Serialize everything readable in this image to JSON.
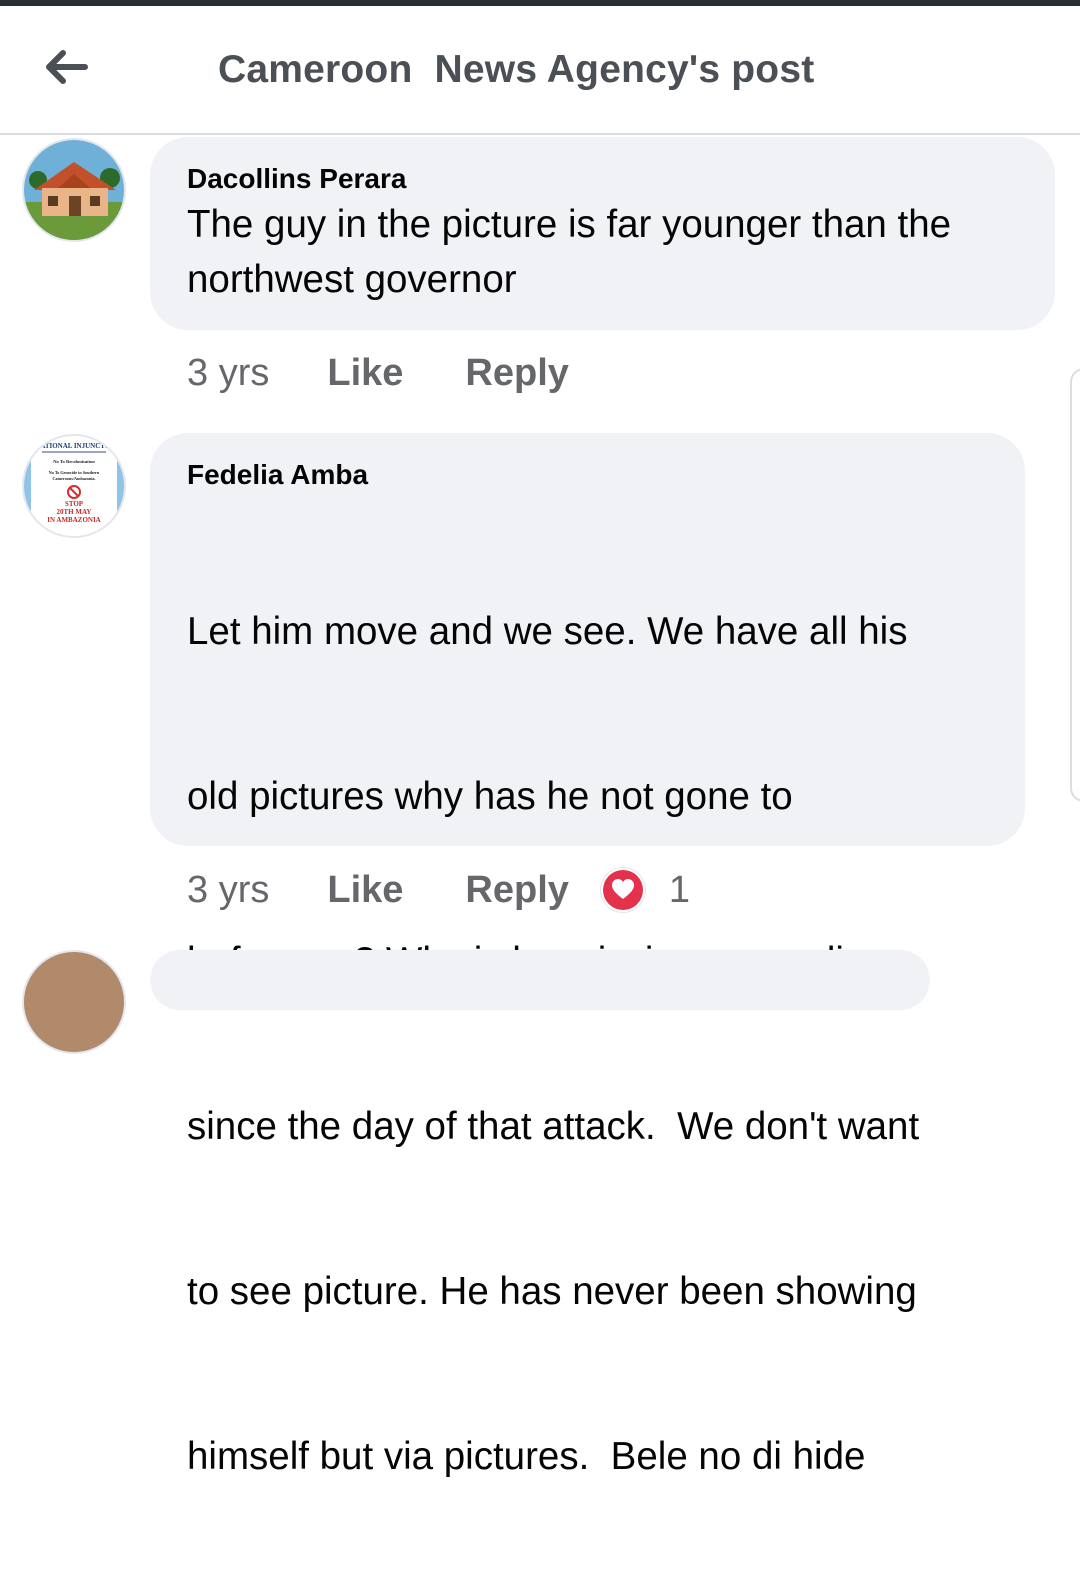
{
  "header": {
    "title": "Cameroon  News Agency's post",
    "back_icon": "arrow-left-icon"
  },
  "comments": [
    {
      "author": "Dacollins Perara",
      "lines": [
        "The guy in the picture is far younger than the",
        "northwest governor"
      ],
      "time": "3 yrs",
      "like_label": "Like",
      "reply_label": "Reply",
      "avatar_icon": "house-avatar"
    },
    {
      "author": "Fedelia Amba",
      "lines": [
        "Let him move and we see. We have all his",
        "old pictures why has he not gone to",
        "bafussam? Why is he missing on media",
        "since the day of that attack.  We don't want",
        "to see picture. He has never been showing",
        "himself but via pictures.  Bele no di hide"
      ],
      "time": "3 yrs",
      "like_label": "Like",
      "reply_label": "Reply",
      "reaction_count": "1",
      "reaction_icon": "love-reaction-icon",
      "avatar_icon": "poster-avatar",
      "avatar_text": {
        "line1": "ATIONAL INJUNCTI",
        "line2": "No To Recolonisation",
        "line3": "No To Genocide in Southern",
        "line4": "Cameroons/Ambazonia.",
        "line5": "STOP",
        "line6": "20TH MAY",
        "line7": "IN AMBAZONIA"
      }
    }
  ],
  "colors": {
    "bubble": "#f0f2f5",
    "meta": "#65676b",
    "love": "#e4324d"
  }
}
